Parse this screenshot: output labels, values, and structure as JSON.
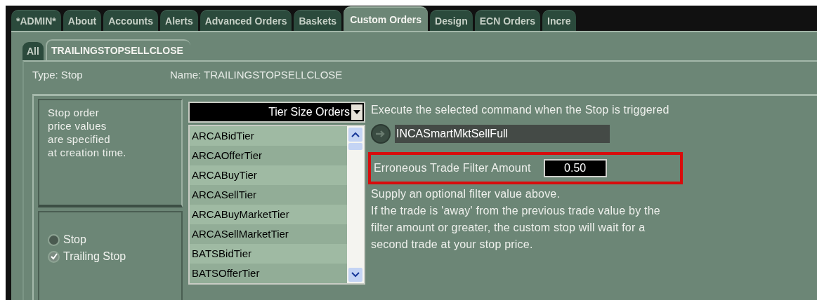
{
  "tabs": [
    {
      "label": "*ADMIN*",
      "selected": false
    },
    {
      "label": "About",
      "selected": false
    },
    {
      "label": "Accounts",
      "selected": false
    },
    {
      "label": "Alerts",
      "selected": false
    },
    {
      "label": "Advanced Orders",
      "selected": false
    },
    {
      "label": "Baskets",
      "selected": false
    },
    {
      "label": "Custom Orders",
      "selected": true
    },
    {
      "label": "Design",
      "selected": false
    },
    {
      "label": "ECN Orders",
      "selected": false
    },
    {
      "label": "Incre",
      "selected": false
    }
  ],
  "sub_tabs": [
    {
      "label": "All",
      "selected": false
    },
    {
      "label": "TRAILINGSTOPSELLCLOSE",
      "selected": true
    }
  ],
  "type_label": "Type: Stop",
  "name_label": "Name: TRAILINGSTOPSELLCLOSE",
  "description": "Stop order\nprice values\nare specified\nat creation time.",
  "stop_options": [
    {
      "label": "Stop",
      "selected": false
    },
    {
      "label": "Trailing Stop",
      "selected": true
    }
  ],
  "category_dropdown": {
    "value": "Tier Size Orders"
  },
  "commands": [
    "ARCABidTier",
    "ARCAOfferTier",
    "ARCABuyTier",
    "ARCASellTier",
    "ARCABuyMarketTier",
    "ARCASellMarketTier",
    "BATSBidTier",
    "BATSOfferTier"
  ],
  "execute_label": "Execute the selected command when the Stop is triggered",
  "selected_command": "INCASmartMktSellFull",
  "filter": {
    "label": "Erroneous Trade Filter Amount",
    "value": "0.50",
    "highlighted": true
  },
  "help_lines": [
    "Supply an optional filter value above.",
    "If the trade is 'away' from the previous trade value by the",
    "filter amount or greater, the custom stop will wait for a",
    "second trade at your stop price."
  ]
}
